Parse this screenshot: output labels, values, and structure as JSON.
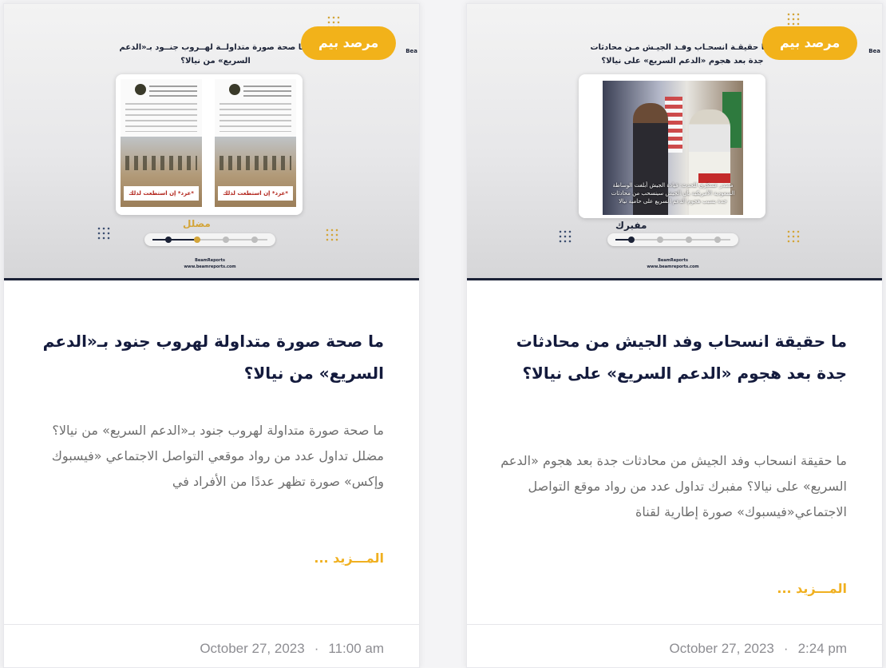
{
  "cards": [
    {
      "badge": "مرصد بيم",
      "thumb_heading": "مــا صحة صورة متداولــة لهــروب جنــود بـ«الدعم السريع» من نيالا؟",
      "brand_tag": "Bea",
      "post_a_caption": "*عرد* إن استطعت لذلك سبيلا",
      "post_b_caption": "*عرد* إن استطعت لذلك سبيلا",
      "verdict": "مضلل",
      "verdict_color": "#d3a53a",
      "social_handle": "BeamReports",
      "social_site": "www.beamreports.com",
      "title": "ما صحة صورة متداولة لهروب جنود بـ«الدعم السريع» من نيالا؟",
      "excerpt": "ما صحة صورة متداولة لهروب جنود بـ«الدعم السريع» من نيالا؟ مضلل تداول عدد من رواد موقعي التواصل الاجتماعي «فيسبوك وإكس» صورة تظهر عددًا من الأفراد في",
      "more_label": "المـــزيد ...",
      "date": "October 27, 2023",
      "separator": "·",
      "time": "11:00 am"
    },
    {
      "badge": "مرصد بيم",
      "thumb_heading": "مــا حقيقـة انسحـاب وفـد الجيـش مـن محادثات جدة بعد هجوم «الدعم السريع» على نيالا؟",
      "brand_tag": "Bea",
      "photo_caption": "مصدر عسكري للحدث: قيادة الجيش أبلغت الوساطة السعودية الأمريكية بأن الجيش سينسحب من محادثات جدة بسبب هجوم الدعم السريع على حامية نيالا",
      "verdict": "مفبرك",
      "verdict_color": "#1b2236",
      "social_handle": "BeamReports",
      "social_site": "www.beamreports.com",
      "title": "ما حقيقة انسحاب وفد الجيش من محادثات جدة بعد هجوم «الدعم السريع» على نيالا؟",
      "excerpt": "ما حقيقة انسحاب وفد الجيش من محادثات جدة بعد هجوم «الدعم السريع» على نيالا؟ مفبرك  تداول عدد من رواد موقع التواصل الاجتماعي«فيسبوك» صورة إطارية لقناة",
      "more_label": "المـــزيد ...",
      "date": "October 27, 2023",
      "separator": "·",
      "time": "2:24 pm"
    }
  ],
  "colors": {
    "accent": "#f2b21a",
    "title": "#131a3c",
    "text": "#6e6e6e",
    "meta": "#8d8d92"
  }
}
